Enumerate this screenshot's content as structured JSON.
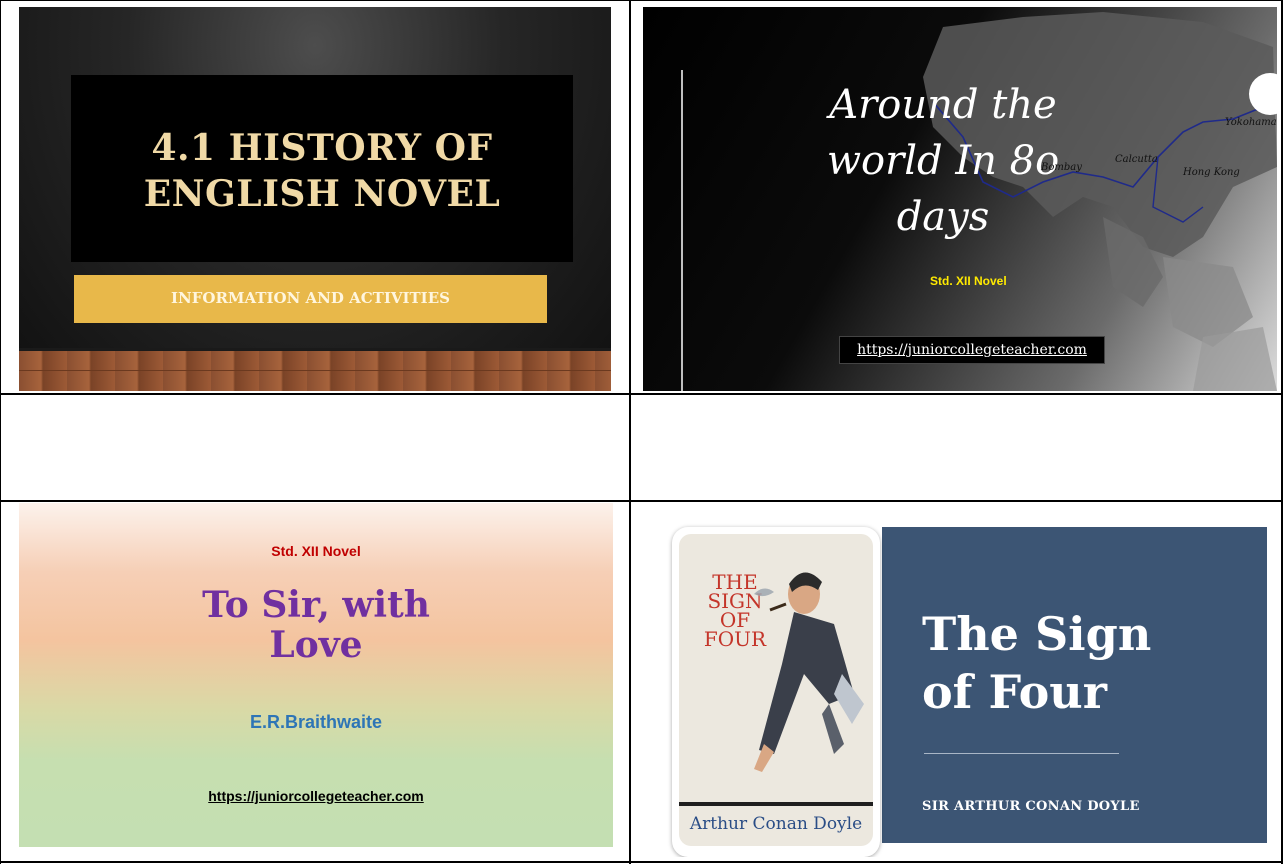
{
  "slide1": {
    "title": "4.1 HISTORY OF ENGLISH NOVEL",
    "subtitle": "INFORMATION AND ACTIVITIES"
  },
  "slide2": {
    "title": "Around the world In 8o days",
    "tag": "Std. XII Novel",
    "url": "https://juniorcollegeteacher.com",
    "cities": [
      "Bombay",
      "Calcutta",
      "Hong Kong",
      "Yokohama"
    ]
  },
  "slide3": {
    "tag": "Std. XII Novel",
    "title": "To Sir, with Love",
    "author": "E.R.Braithwaite",
    "url": "https://juniorcollegeteacher.com"
  },
  "slide4": {
    "title": "The Sign of Four",
    "author": "SIR ARTHUR CONAN DOYLE",
    "cover_title": "THE SIGN OF FOUR",
    "cover_author": "Arthur Conan Doyle"
  },
  "colors": {
    "gold": "#e8b84a",
    "title_cream": "#f0d9a6",
    "purple": "#7030a0",
    "blue": "#2e75b6",
    "red": "#c00000",
    "yellow": "#ffea00",
    "navy_panel": "#3c5574"
  }
}
